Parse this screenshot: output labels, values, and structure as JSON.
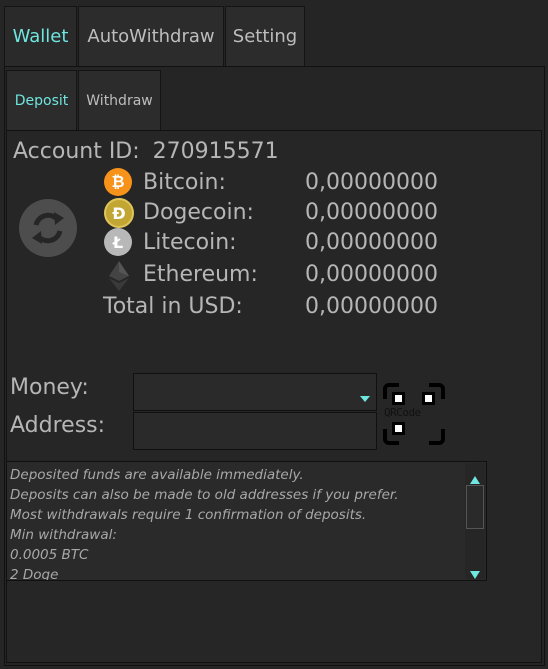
{
  "tabs": [
    {
      "label": "Wallet"
    },
    {
      "label": "AutoWithdraw"
    },
    {
      "label": "Setting"
    }
  ],
  "subtabs": [
    {
      "label": "Deposit"
    },
    {
      "label": "Withdraw"
    }
  ],
  "account": {
    "label": "Account ID:",
    "id": "270915571"
  },
  "balances": [
    {
      "name": "Bitcoin:",
      "value": "0,00000000",
      "icon": "bitcoin-icon"
    },
    {
      "name": "Dogecoin:",
      "value": "0,00000000",
      "icon": "dogecoin-icon"
    },
    {
      "name": "Litecoin:",
      "value": "0,00000000",
      "icon": "litecoin-icon"
    },
    {
      "name": "Ethereum:",
      "value": "0,00000000",
      "icon": "ethereum-icon"
    }
  ],
  "total": {
    "label": "Total in USD:",
    "value": "0,00000000"
  },
  "form": {
    "money_label": "Money:",
    "address_label": "Address:",
    "money_value": "",
    "address_value": ""
  },
  "qrcode": {
    "text": "QRCode"
  },
  "notes": [
    "Deposited funds are available immediately.",
    "Deposits can also be made to old addresses if you prefer.",
    "Most withdrawals require 1 confirmation of deposits.",
    "Min withdrawal:",
    "0.0005 BTC",
    "2 Doge"
  ],
  "colors": {
    "accent": "#6fe6df",
    "bitcoin": "#f7931a",
    "dogecoin": "#c2a633",
    "litecoin": "#b8b8b8"
  }
}
